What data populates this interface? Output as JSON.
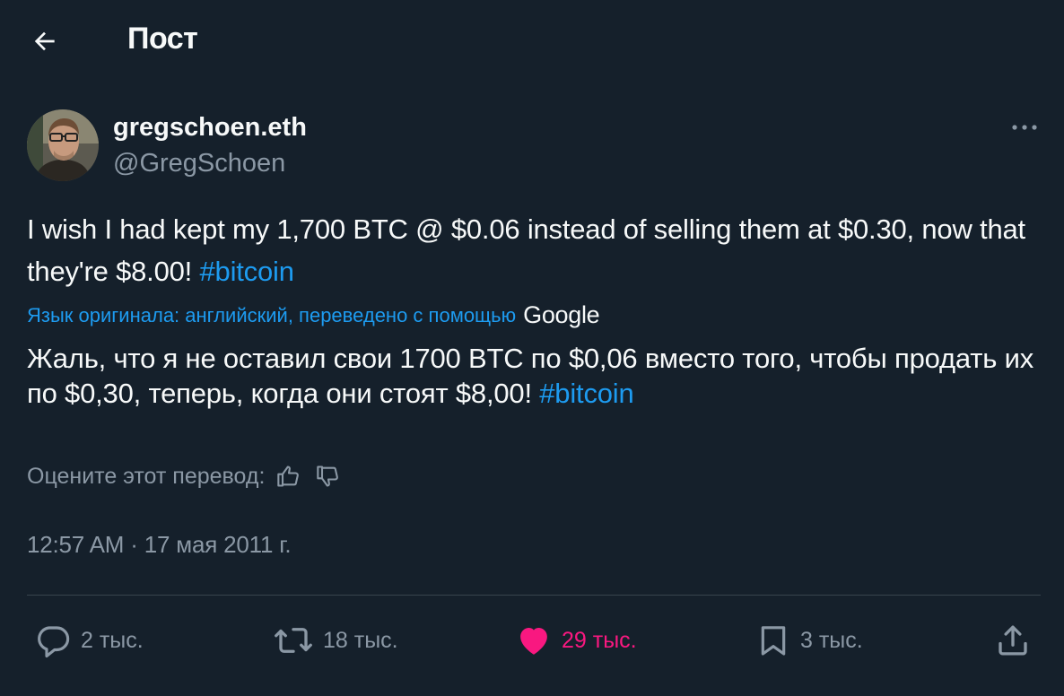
{
  "header": {
    "title": "Пост"
  },
  "author": {
    "display_name": "gregschoen.eth",
    "handle": "@GregSchoen"
  },
  "tweet": {
    "text": "I wish I had kept my 1,700 BTC @ $0.06 instead of selling them at $0.30, now that they're $8.00! ",
    "hashtag": "#bitcoin"
  },
  "translation": {
    "note": "Язык оригинала: английский, переведено с помощью",
    "provider": "Google",
    "text": "Жаль, что я не оставил свои 1700 BTC по $0,06 вместо того, чтобы продать их по $0,30, теперь, когда они стоят $8,00! ",
    "hashtag": "#bitcoin"
  },
  "rate": {
    "label": "Оцените этот перевод:"
  },
  "timestamp": "12:57 AM · 17 мая 2011 г.",
  "actions": {
    "replies": "2 тыс.",
    "reposts": "18 тыс.",
    "likes": "29 тыс.",
    "bookmarks": "3 тыс."
  },
  "colors": {
    "background": "#15202b",
    "text": "#f7f9f9",
    "secondary": "#8b98a5",
    "accent": "#1d9bf0",
    "like": "#f91880"
  },
  "icons": {
    "back": "arrow-left-icon",
    "more": "more-icon",
    "like_translation": "thumbs-up-icon",
    "dislike_translation": "thumbs-down-icon",
    "reply": "reply-icon",
    "repost": "repost-icon",
    "like": "heart-icon",
    "bookmark": "bookmark-icon",
    "share": "share-icon"
  }
}
